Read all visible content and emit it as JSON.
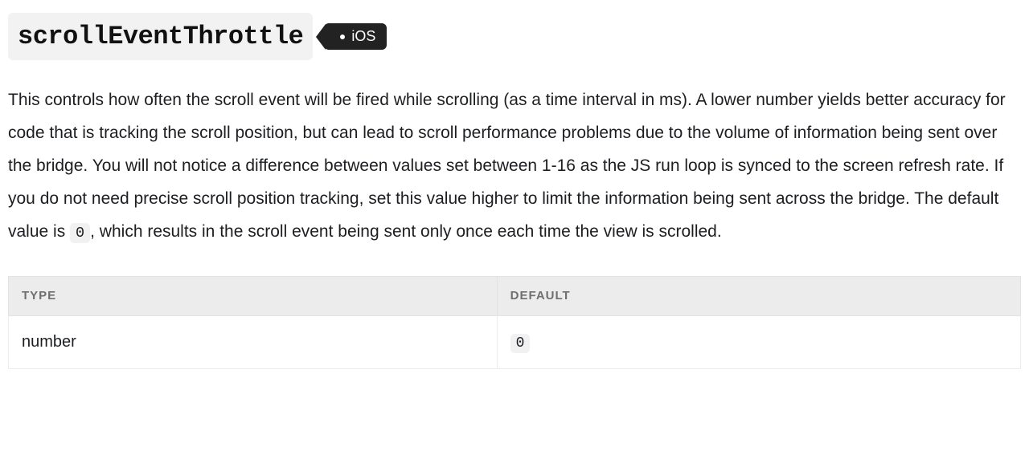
{
  "prop": {
    "name": "scrollEventThrottle",
    "platform": "iOS"
  },
  "description": {
    "text_before_code": "This controls how often the scroll event will be fired while scrolling (as a time interval in ms). A lower number yields better accuracy for code that is tracking the scroll position, but can lead to scroll performance problems due to the volume of information being sent over the bridge. You will not notice a difference between values set between 1-16 as the JS run loop is synced to the screen refresh rate. If you do not need precise scroll position tracking, set this value higher to limit the information being sent across the bridge. The default value is ",
    "code": "0",
    "text_after_code": ", which results in the scroll event being sent only once each time the view is scrolled."
  },
  "table": {
    "headers": {
      "type": "TYPE",
      "default": "DEFAULT"
    },
    "row": {
      "type": "number",
      "default": "0"
    }
  }
}
